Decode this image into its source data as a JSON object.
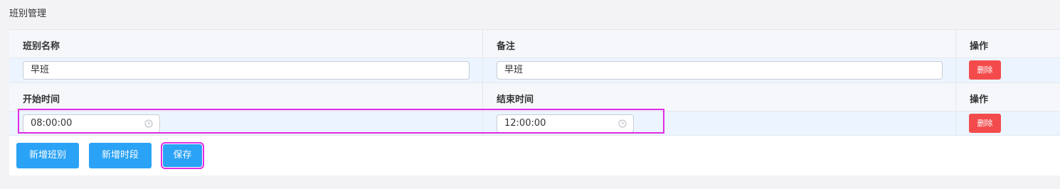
{
  "page": {
    "title": "班别管理"
  },
  "shift_table": {
    "headers": [
      "班别名称",
      "备注",
      "操作"
    ],
    "row": {
      "name": "早班",
      "remark": "早班",
      "delete_label": "删除"
    }
  },
  "period_table": {
    "headers": [
      "开始时间",
      "结束时间",
      "操作"
    ],
    "row": {
      "start": "08:00:00",
      "end": "12:00:00",
      "delete_label": "删除"
    }
  },
  "actions": {
    "add_shift": "新增班别",
    "add_period": "新增时段",
    "save": "保存"
  },
  "colors": {
    "primary": "#2aa2f5",
    "danger": "#f34b4b",
    "highlight": "#e02ce5",
    "row_selected": "#ecf5ff"
  },
  "icons": {
    "time": "clock-icon"
  }
}
